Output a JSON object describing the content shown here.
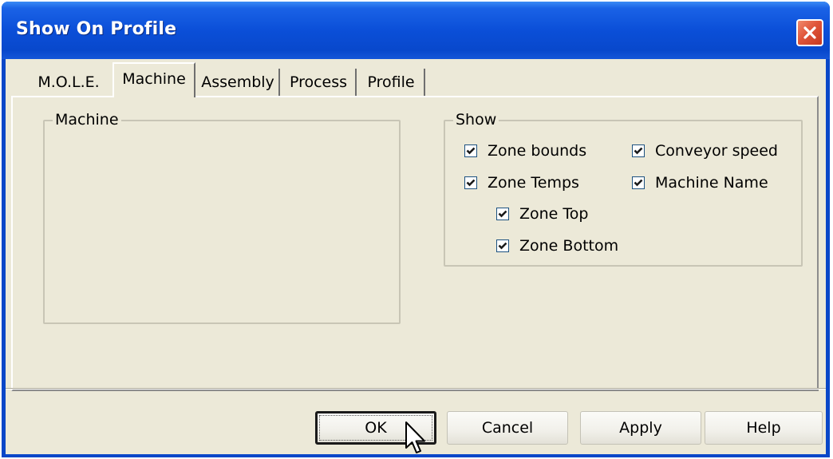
{
  "window": {
    "title": "Show On Profile"
  },
  "tabs": [
    {
      "label": "M.O.L.E.",
      "active": false
    },
    {
      "label": "Machine",
      "active": true
    },
    {
      "label": "Assembly",
      "active": false
    },
    {
      "label": "Process",
      "active": false
    },
    {
      "label": "Profile",
      "active": false
    }
  ],
  "machine_group": {
    "label": "Machine"
  },
  "show_group": {
    "label": "Show",
    "checkboxes": [
      {
        "label": "Zone bounds",
        "checked": true
      },
      {
        "label": "Conveyor speed",
        "checked": true
      },
      {
        "label": "Zone Temps",
        "checked": true
      },
      {
        "label": "Machine Name",
        "checked": true
      },
      {
        "label": "Zone Top",
        "checked": true
      },
      {
        "label": "Zone Bottom",
        "checked": true
      }
    ]
  },
  "buttons": {
    "ok": "OK",
    "cancel": "Cancel",
    "apply": "Apply",
    "help": "Help"
  },
  "colors": {
    "titlebar": "#0b4fd8",
    "dialog_bg": "#ece9d8",
    "close_button": "#e0553a"
  },
  "icons": {
    "close": "close-x-icon",
    "check": "checkmark-icon",
    "cursor": "arrow-cursor-icon"
  }
}
